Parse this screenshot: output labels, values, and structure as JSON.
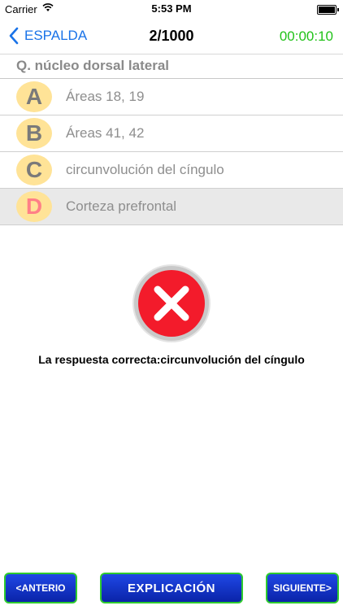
{
  "status_bar": {
    "carrier": "Carrier",
    "time": "5:53 PM"
  },
  "nav": {
    "back_label": "ESPALDA",
    "title": "2/1000",
    "timer": "00:00:10"
  },
  "question": "Q. núcleo dorsal lateral",
  "options": [
    {
      "letter": "A",
      "text": "Áreas 18, 19"
    },
    {
      "letter": "B",
      "text": "Áreas 41, 42"
    },
    {
      "letter": "C",
      "text": "circunvolución del cíngulo"
    },
    {
      "letter": "D",
      "text": "Corteza prefrontal"
    }
  ],
  "selected_option": "D",
  "result": {
    "icon": "wrong-icon",
    "text": "La respuesta correcta:circunvolución del cíngulo"
  },
  "buttons": {
    "previous": "<ANTERIO",
    "explain": "EXPLICACIÓN",
    "next": "SIGUIENTE>"
  },
  "colors": {
    "accent": "#1a73e8",
    "timer": "#22c21a",
    "badge": "#ffe397",
    "wrong": "#ff7f87",
    "button": "#1f48e6",
    "button_border": "#2ecb2e"
  }
}
